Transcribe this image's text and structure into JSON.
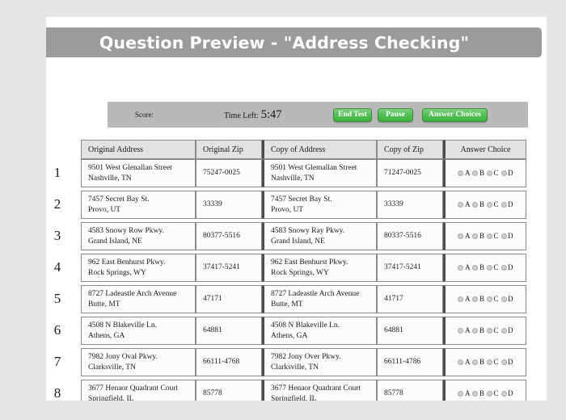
{
  "header": {
    "title": "Question Preview - \"Address Checking\""
  },
  "toolbar": {
    "score_label": "Score:",
    "score_value": "",
    "time_label": "Time Left:",
    "time_value": "5:47",
    "end_test_label": "End Test",
    "pause_label": "Pause",
    "answer_choices_label": "Answer Choices",
    "button_color": "#4ebb51"
  },
  "table": {
    "columns": [
      "Original Address",
      "Original Zip",
      "Copy of Address",
      "Copy of Zip",
      "Answer Choice"
    ],
    "answer_options": [
      "A",
      "B",
      "C",
      "D"
    ],
    "rows": [
      {
        "number": "1",
        "original_address_line1": "9501 West Glenallan Street",
        "original_address_line2": "Nashville, TN",
        "original_zip": "75247-0025",
        "copy_address_line1": "9501 West Glemallan Street",
        "copy_address_line2": "Nashville, TN",
        "copy_zip": "71247-0025"
      },
      {
        "number": "2",
        "original_address_line1": "7457 Secret Bay St.",
        "original_address_line2": "Provo, UT",
        "original_zip": "33339",
        "copy_address_line1": "7457 Secret Bay St.",
        "copy_address_line2": "Provo, UT",
        "copy_zip": "33339"
      },
      {
        "number": "3",
        "original_address_line1": "4583 Snowy Row Pkwy.",
        "original_address_line2": "Grand Island, NE",
        "original_zip": "80377-5516",
        "copy_address_line1": "4583 Snowy Ray Pkwy.",
        "copy_address_line2": "Grand Island, NE",
        "copy_zip": "80337-5516"
      },
      {
        "number": "4",
        "original_address_line1": "962 East Benhurst Pkwy.",
        "original_address_line2": "Rock Springs, WY",
        "original_zip": "37417-5241",
        "copy_address_line1": "962 East Benhurst Pkwy.",
        "copy_address_line2": "Rock Springs, WY",
        "copy_zip": "37417-5241"
      },
      {
        "number": "5",
        "original_address_line1": "8727 Ladeastle Arch Avenue",
        "original_address_line2": "Butte, MT",
        "original_zip": "47171",
        "copy_address_line1": "8727 Ladeastle Arch Avenue",
        "copy_address_line2": "Butte, MT",
        "copy_zip": "41717"
      },
      {
        "number": "6",
        "original_address_line1": "4508 N Blakeville Ln.",
        "original_address_line2": "Athens, GA",
        "original_zip": "64881",
        "copy_address_line1": "4508 N Blakeville Ln.",
        "copy_address_line2": "Athens, GA",
        "copy_zip": "64881"
      },
      {
        "number": "7",
        "original_address_line1": "7982 Jony Oval Pkwy.",
        "original_address_line2": "Clarksville, TN",
        "original_zip": "66111-4768",
        "copy_address_line1": "7982 Jony Over Pkwy.",
        "copy_address_line2": "Clarksville, TN",
        "copy_zip": "66111-4786"
      },
      {
        "number": "8",
        "original_address_line1": "3677 Henaor Quadrant Court",
        "original_address_line2": "Springfield, IL",
        "original_zip": "85778",
        "copy_address_line1": "3677 Henaor Quadrant Court",
        "copy_address_line2": "Springfield, IL",
        "copy_zip": "85778"
      }
    ]
  }
}
